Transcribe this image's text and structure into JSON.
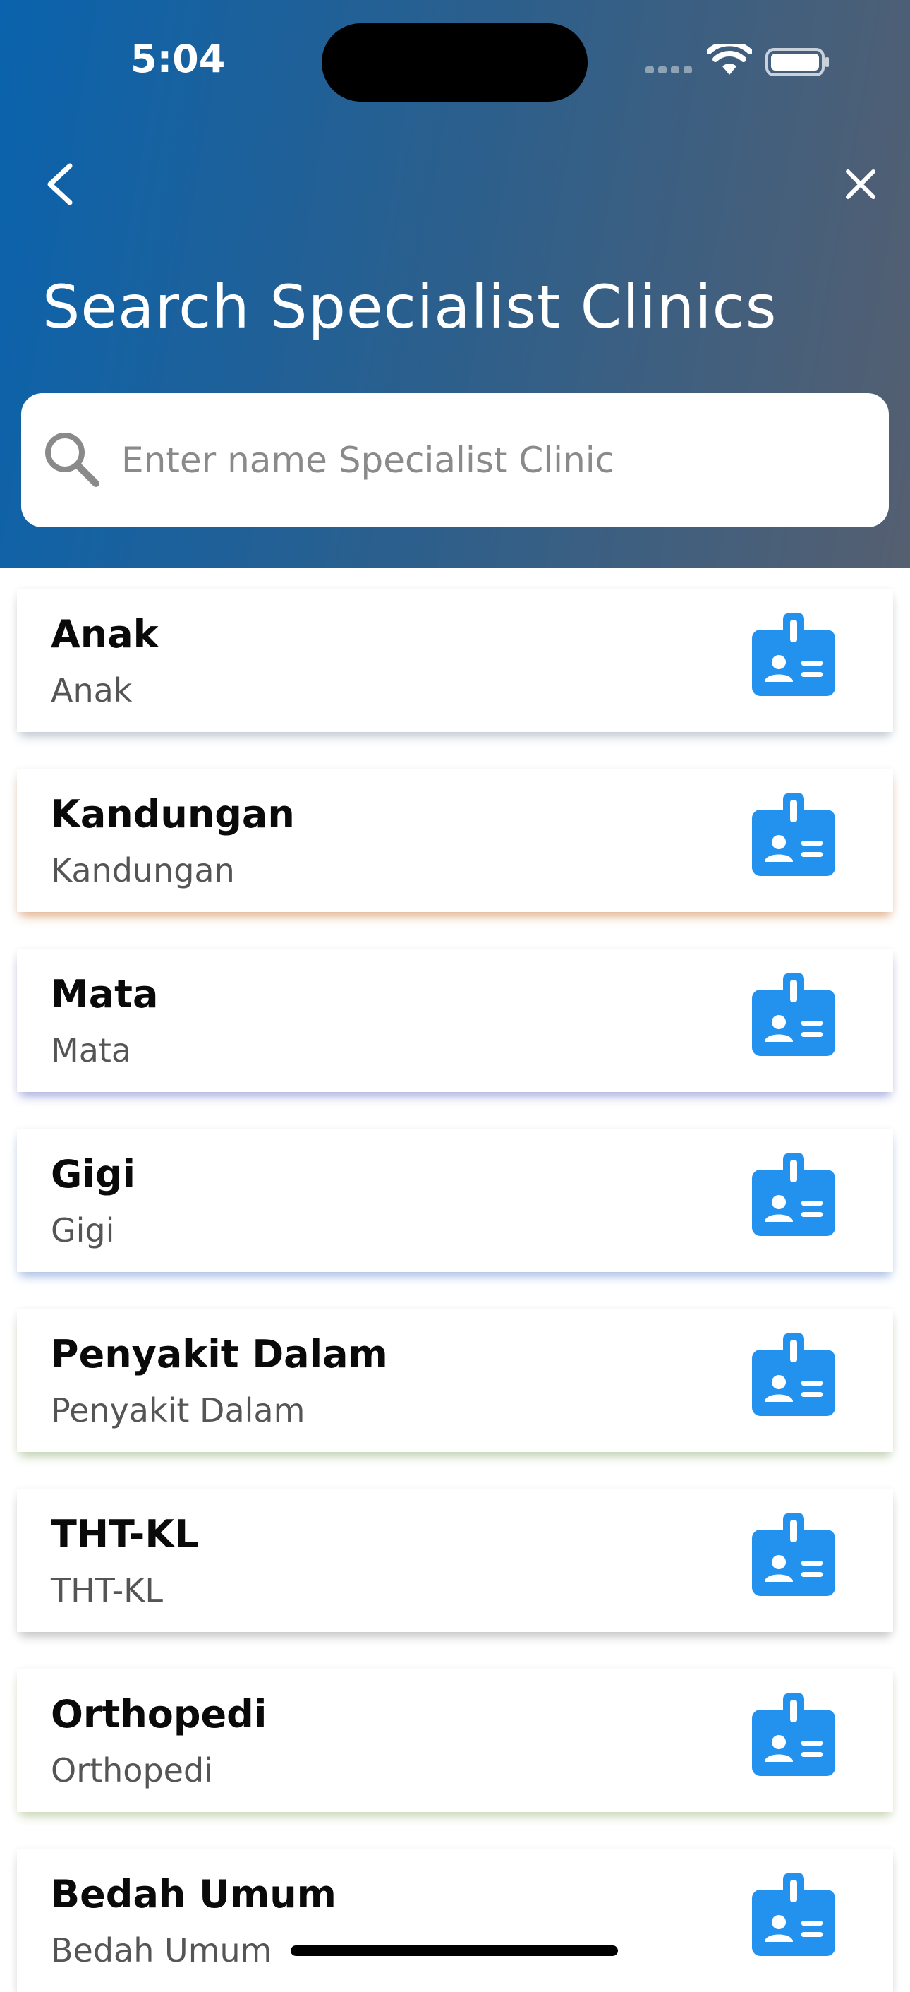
{
  "status_bar": {
    "time": "5:04"
  },
  "header": {
    "title": "Search Specialist Clinics",
    "back_icon": "chevron-left-icon",
    "close_icon": "close-icon"
  },
  "search": {
    "placeholder": "Enter name Specialist Clinic",
    "value": ""
  },
  "colors": {
    "header_gradient_start": "#0a63ad",
    "header_gradient_end": "#555f70",
    "icon_blue": "#2392ee"
  },
  "clinics": [
    {
      "name": "Anak",
      "subtitle": "Anak",
      "shadow": "#bfc6d0"
    },
    {
      "name": "Kandungan",
      "subtitle": "Kandungan",
      "shadow": "#e3b28e"
    },
    {
      "name": "Mata",
      "subtitle": "Mata",
      "shadow": "#a7aee0"
    },
    {
      "name": "Gigi",
      "subtitle": "Gigi",
      "shadow": "#a6bde6"
    },
    {
      "name": "Penyakit Dalam",
      "subtitle": "Penyakit Dalam",
      "shadow": "#bfd0b0"
    },
    {
      "name": "THT-KL",
      "subtitle": "THT-KL",
      "shadow": "#c2c2c2"
    },
    {
      "name": "Orthopedi",
      "subtitle": "Orthopedi",
      "shadow": "#c8d6b4"
    },
    {
      "name": "Bedah Umum",
      "subtitle": "Bedah Umum",
      "shadow": "#c5c9cf"
    }
  ]
}
